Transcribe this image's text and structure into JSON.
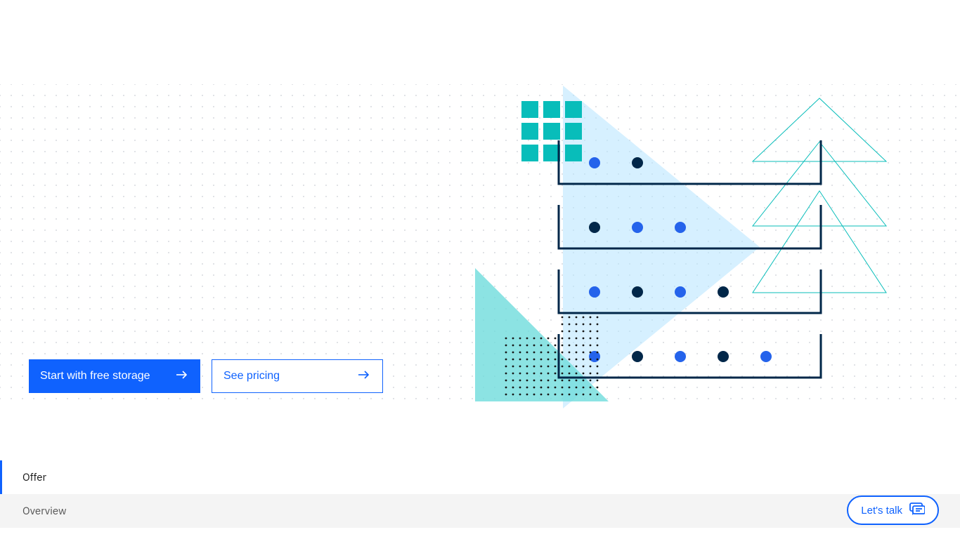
{
  "hero": {
    "primary_cta": "Start with free storage",
    "secondary_cta": "See pricing"
  },
  "sidenav": {
    "items": [
      {
        "label": "Offer",
        "active": true
      },
      {
        "label": "Overview",
        "active": false
      }
    ]
  },
  "chat": {
    "label": "Let's talk"
  },
  "colors": {
    "primary": "#0f62fe",
    "teal": "#08bdba",
    "cyan_light": "#bae6ff",
    "cyan_pale": "#d1f2f5",
    "navy": "#012749"
  }
}
